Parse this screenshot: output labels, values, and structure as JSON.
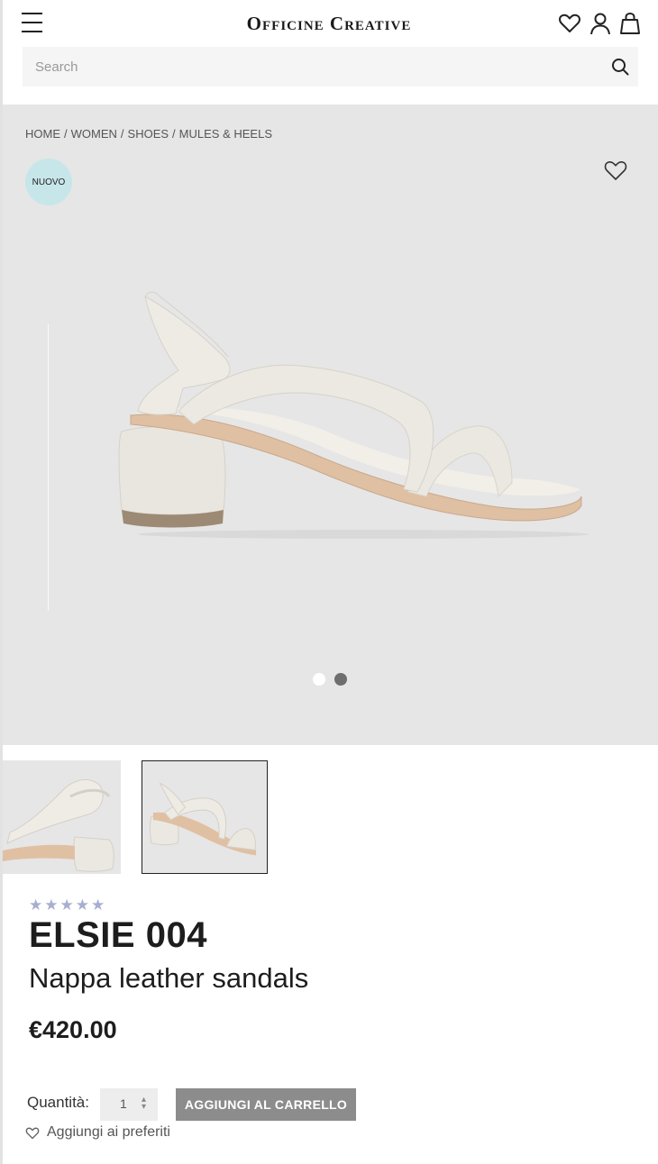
{
  "header": {
    "logo": "Officine Creative",
    "icons": [
      "menu-icon",
      "heart-icon",
      "user-icon",
      "bag-icon"
    ]
  },
  "search": {
    "placeholder": "Search",
    "value": ""
  },
  "breadcrumb": [
    {
      "label": "HOME"
    },
    {
      "label": "WOMEN"
    },
    {
      "label": "SHOES"
    },
    {
      "label": "MULES & HEELS"
    }
  ],
  "gallery": {
    "badge": "NUOVO",
    "slide_count": 2,
    "active_slide": 2,
    "background": "#e6e6e6"
  },
  "product": {
    "rating_stars": 5,
    "name": "ELSIE 004",
    "subtitle": "Nappa leather sandals",
    "price": "€420.00"
  },
  "purchase": {
    "quantity_label": "Quantità:",
    "quantity_value": "1",
    "add_to_cart": "AGGIUNGI AL CARRELLO",
    "add_to_favorites": "Aggiungi ai preferiti"
  },
  "colors": {
    "badge": "#c7e6ea",
    "stars": "#a7aed0",
    "cart_button": "#8c8c8c"
  }
}
